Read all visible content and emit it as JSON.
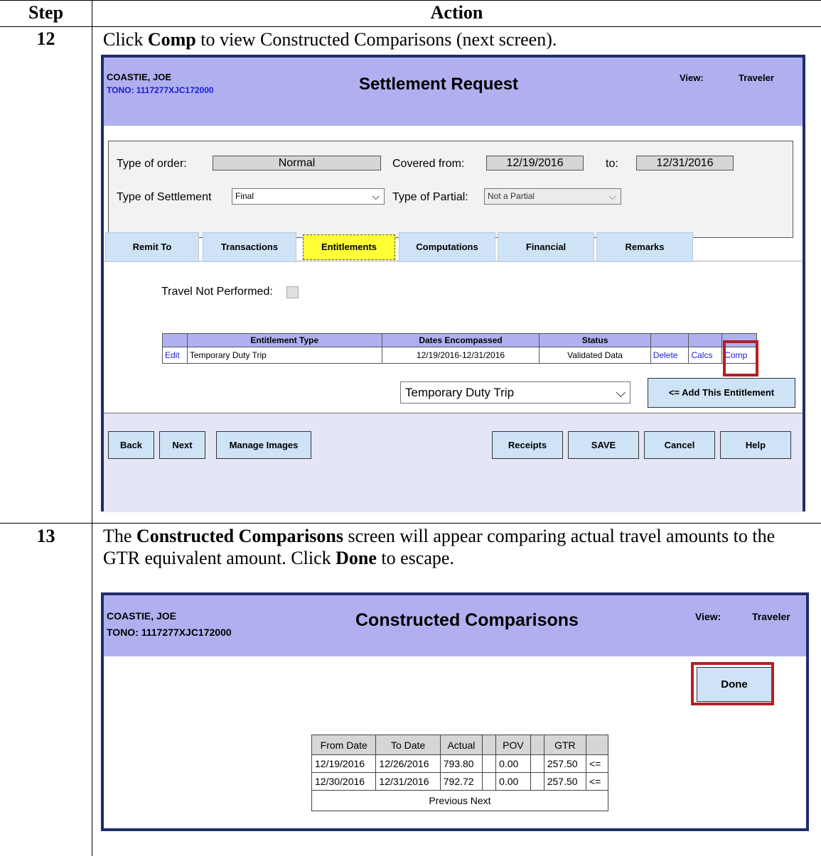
{
  "headers": {
    "step": "Step",
    "action": "Action"
  },
  "step12": {
    "num": "12",
    "instr_a": "Click ",
    "instr_b": "Comp",
    "instr_c": " to view Constructed Comparisons (next screen).",
    "shot": {
      "name": "COASTIE, JOE",
      "tono": "TONO: 1117277XJC172000",
      "title": "Settlement Request",
      "view_label": "View:",
      "view_value": "Traveler",
      "type_of_order_label": "Type of order:",
      "type_of_order_value": "Normal",
      "covered_from_label": "Covered from:",
      "covered_from_value": "12/19/2016",
      "to_label": "to:",
      "to_value": "12/31/2016",
      "settlement_label": "Type of Settlement",
      "settlement_value": "Final",
      "partial_label": "Type of Partial:",
      "partial_value": "Not a Partial",
      "tabs": [
        "Remit To",
        "Transactions",
        "Entitlements",
        "Computations",
        "Financial",
        "Remarks"
      ],
      "active_tab": "Entitlements",
      "tnp_label": "Travel Not Performed:",
      "table_headers": [
        "",
        "Entitlement Type",
        "Dates Encompassed",
        "Status",
        "",
        "",
        ""
      ],
      "row": {
        "edit": "Edit",
        "type": "Temporary Duty Trip",
        "dates": "12/19/2016-12/31/2016",
        "status": "Validated Data",
        "delete": "Delete",
        "calcs": "Calcs",
        "comp": "Comp"
      },
      "entitlement_select": "Temporary Duty Trip",
      "add_button": "<= Add This Entitlement",
      "buttons": {
        "back": "Back",
        "next": "Next",
        "manage": "Manage Images",
        "receipts": "Receipts",
        "save": "SAVE",
        "cancel": "Cancel",
        "help": "Help"
      }
    }
  },
  "step13": {
    "num": "13",
    "instr_a": "The ",
    "instr_b": "Constructed Comparisons",
    "instr_c": " screen will appear comparing actual travel amounts to the GTR equivalent amount.   Click ",
    "instr_d": "Done",
    "instr_e": " to escape.",
    "shot": {
      "name": "COASTIE, JOE",
      "tono": "TONO: 1117277XJC172000",
      "title": "Constructed Comparisons",
      "view_label": "View:",
      "view_value": "Traveler",
      "done": "Done",
      "headers": [
        "From Date",
        "To Date",
        "Actual",
        "",
        "POV",
        "",
        "GTR",
        ""
      ],
      "rows": [
        [
          "12/19/2016",
          "12/26/2016",
          "793.80",
          "",
          "0.00",
          "",
          "257.50",
          "<="
        ],
        [
          "12/30/2016",
          "12/31/2016",
          "792.72",
          "",
          "0.00",
          "",
          "257.50",
          "<="
        ]
      ],
      "pager": "Previous Next"
    }
  }
}
